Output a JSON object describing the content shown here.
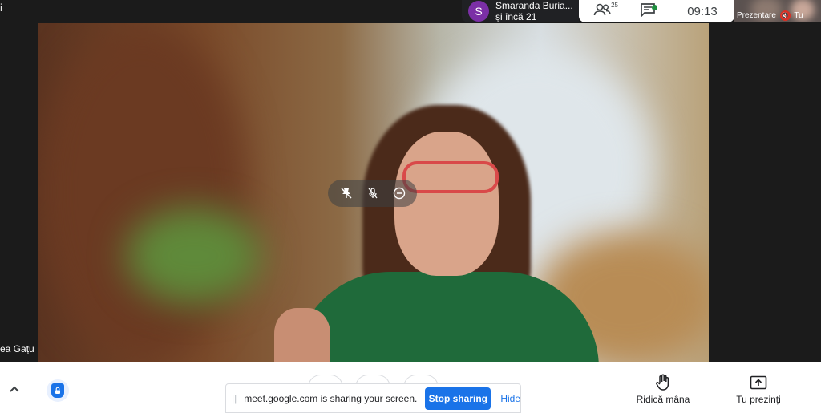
{
  "topleft": {
    "text": "i"
  },
  "participant": {
    "name": "ea Gațu"
  },
  "tile_controls": [
    {
      "name": "pin-off-icon"
    },
    {
      "name": "mic-off-icon"
    },
    {
      "name": "remove-icon"
    }
  ],
  "speaker_panel": {
    "avatar_letter": "S",
    "name": "Smaranda Buria...",
    "others": "și încă 21",
    "avatar_color": "#7b2fa6"
  },
  "toolbar": {
    "people_count": "25",
    "time": "09:13"
  },
  "self_view": {
    "label_left": "Prezentare",
    "label_right": "Tu"
  },
  "share_notice": {
    "message": "meet.google.com is sharing your screen.",
    "stop_label": "Stop sharing",
    "hide_label": "Hide"
  },
  "actions": {
    "raise_hand": "Ridică mâna",
    "present": "Tu prezinți"
  },
  "colors": {
    "accent": "#1a73e8",
    "status_green": "#1e8e3e",
    "muted_red": "#d93025"
  }
}
